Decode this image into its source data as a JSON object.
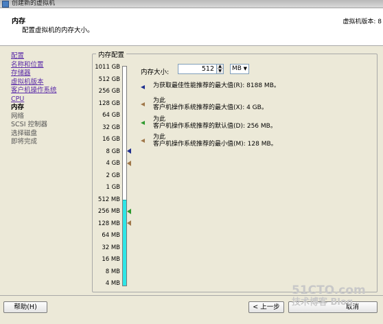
{
  "window": {
    "title": "创建新的虚拟机"
  },
  "header": {
    "title": "内存",
    "subtitle": "配置虚拟机的内存大小。",
    "version": "虚拟机版本: 8"
  },
  "sidebar": {
    "steps": [
      {
        "label": "配置",
        "state": "link"
      },
      {
        "label": "名称和位置",
        "state": "link"
      },
      {
        "label": "存储器",
        "state": "link"
      },
      {
        "label": "虚拟机版本",
        "state": "link"
      },
      {
        "label": "客户机操作系统",
        "state": "link"
      },
      {
        "label": "CPU",
        "state": "link"
      },
      {
        "label": "内存",
        "state": "current"
      },
      {
        "label": "网络",
        "state": "future"
      },
      {
        "label": "SCSI 控制器",
        "state": "future"
      },
      {
        "label": "选择磁盘",
        "state": "future"
      },
      {
        "label": "即将完成",
        "state": "future"
      }
    ]
  },
  "memory": {
    "group_title": "内存配置",
    "size_label": "内存大小:",
    "size_value": "512",
    "unit": "MB",
    "scale_labels": [
      "1011 GB",
      "512 GB",
      "256 GB",
      "128 GB",
      "64 GB",
      "32 GB",
      "16 GB",
      "8 GB",
      "4 GB",
      "2 GB",
      "1 GB",
      "512 MB",
      "256 MB",
      "128 MB",
      "64 MB",
      "32 MB",
      "16 MB",
      "8 MB",
      "4 MB"
    ],
    "fill_level_mb": 512,
    "markers": [
      {
        "name": "best-performance-marker",
        "level_mb": 8188,
        "color": "#1f2f8f"
      },
      {
        "name": "os-max-marker",
        "level_mb": 4096,
        "color": "#a0784a"
      },
      {
        "name": "os-default-marker",
        "level_mb": 256,
        "color": "#2e9a2e"
      },
      {
        "name": "os-min-marker",
        "level_mb": 128,
        "color": "#a0784a"
      }
    ],
    "legend": [
      {
        "line1": "为获取最佳性能推荐的最大值(R): 8188 MB。",
        "line2": "",
        "color": "#1f2f8f"
      },
      {
        "line1": "为此",
        "line2": "客户机操作系统推荐的最大值(X): 4 GB。",
        "color": "#a0784a"
      },
      {
        "line1": "为此",
        "line2": "客户机操作系统推荐的默认值(D): 256 MB。",
        "color": "#2e9a2e"
      },
      {
        "line1": "为此",
        "line2": "客户机操作系统推荐的最小值(M): 128 MB。",
        "color": "#a0784a"
      }
    ]
  },
  "buttons": {
    "help": "帮助(H)",
    "back": "< 上一步",
    "cancel": "取消"
  },
  "watermark": {
    "line1": "51CTO.com",
    "line2": "技术博客 Blog"
  }
}
